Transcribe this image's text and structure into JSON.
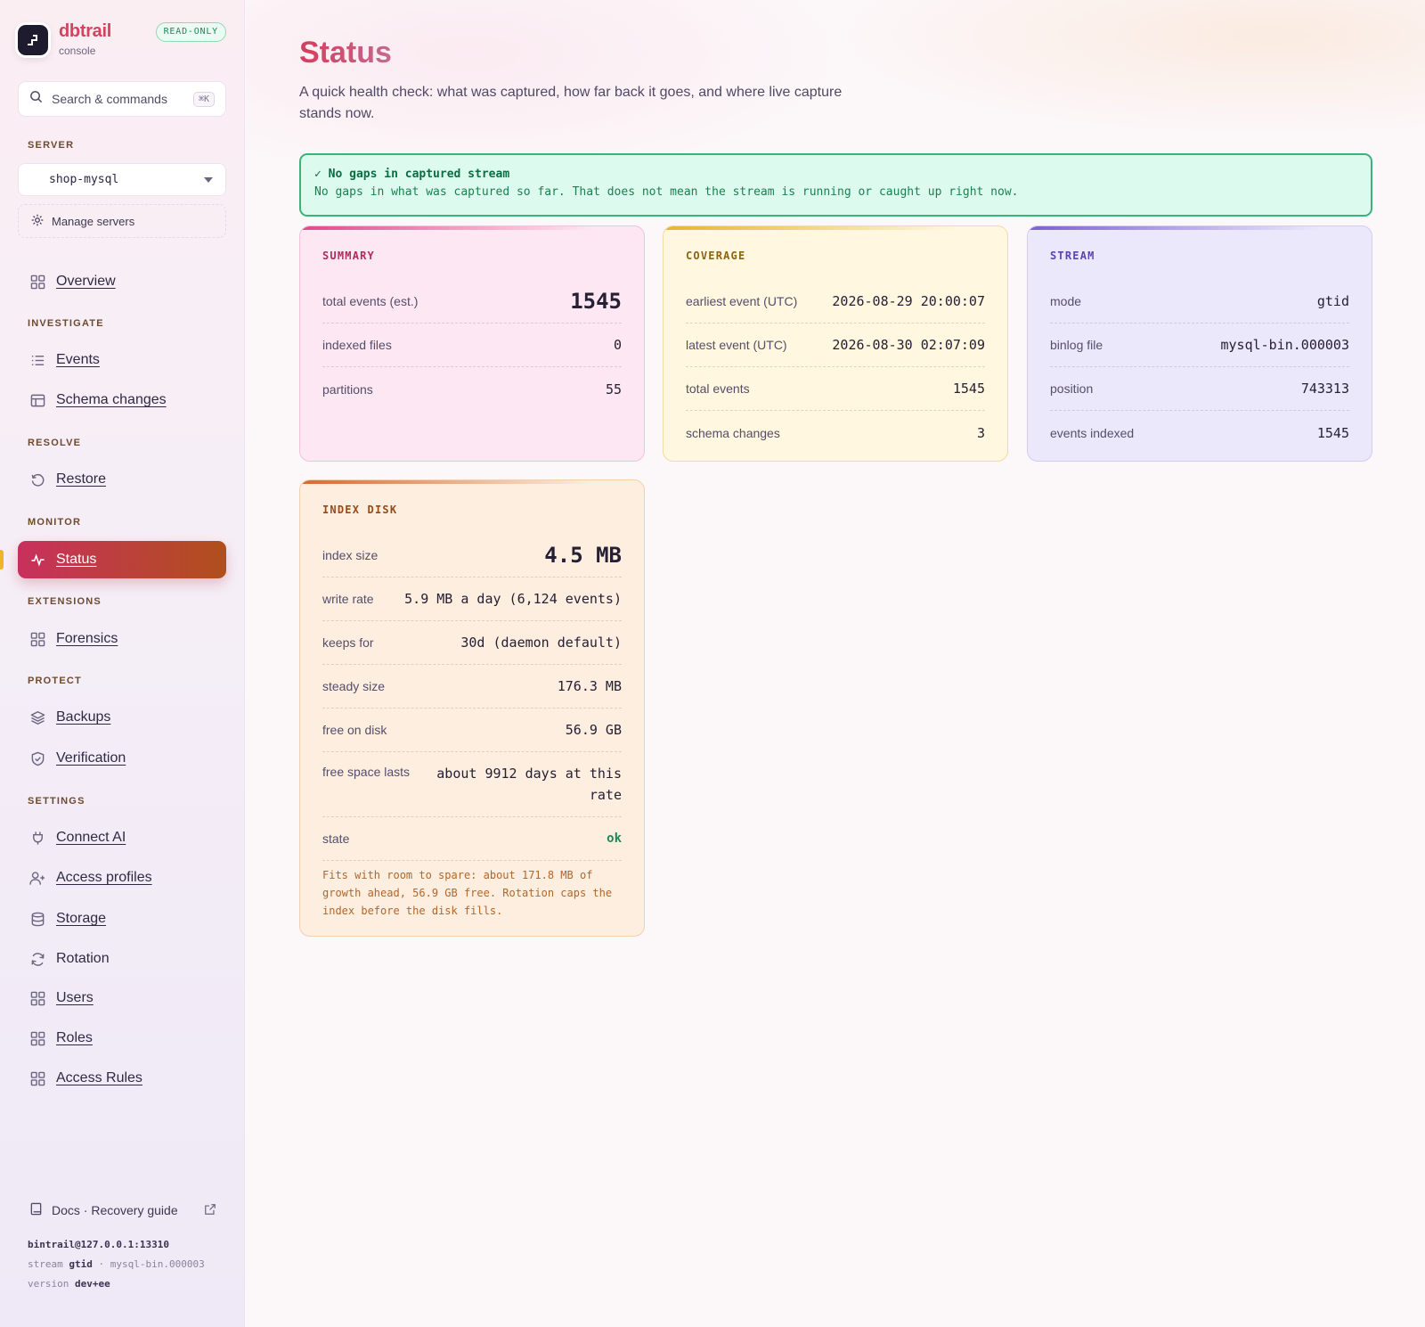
{
  "brand": {
    "name": "dbtrail",
    "sub": "console",
    "badge": "READ-ONLY"
  },
  "search": {
    "label": "Search & commands",
    "shortcut": "⌘K"
  },
  "server": {
    "section": "SERVER",
    "selected": "shop-mysql",
    "manage_label": "Manage servers"
  },
  "sidebar": {
    "overview": "Overview",
    "investigate": {
      "label": "INVESTIGATE",
      "items": [
        "Events",
        "Schema changes"
      ]
    },
    "resolve": {
      "label": "RESOLVE",
      "items": [
        "Restore"
      ]
    },
    "monitor": {
      "label": "MONITOR",
      "items": [
        "Status"
      ]
    },
    "extensions": {
      "label": "EXTENSIONS",
      "items": [
        "Forensics"
      ]
    },
    "protect": {
      "label": "PROTECT",
      "items": [
        "Backups",
        "Verification"
      ]
    },
    "settings": {
      "label": "SETTINGS",
      "items": [
        "Connect AI",
        "Access profiles",
        "Storage",
        "Rotation",
        "Users",
        "Roles",
        "Access Rules"
      ]
    },
    "active_item": "Status"
  },
  "footer": {
    "docs_label": "Docs · Recovery guide",
    "connection": "bintrail@127.0.0.1:13310",
    "stream_prefix": "stream",
    "stream_mode": "gtid",
    "stream_file": "· mysql-bin.000003",
    "version_prefix": "version",
    "version": "dev+ee"
  },
  "page": {
    "title": "Status",
    "description": "A quick health check: what was captured, how far back it goes, and where live capture stands now."
  },
  "banner": {
    "title": "✓ No gaps in captured stream",
    "text": "No gaps in what was captured so far. That does not mean the stream is running or caught up right now."
  },
  "summary": {
    "label": "SUMMARY",
    "total_events_label": "total events (est.)",
    "total_events": "1545",
    "indexed_files_label": "indexed files",
    "indexed_files": "0",
    "partitions_label": "partitions",
    "partitions": "55"
  },
  "coverage": {
    "label": "COVERAGE",
    "earliest_label": "earliest event (UTC)",
    "earliest": "2026-08-29 20:00:07",
    "latest_label": "latest event (UTC)",
    "latest": "2026-08-30 02:07:09",
    "total_events_label": "total events",
    "total_events": "1545",
    "schema_changes_label": "schema changes",
    "schema_changes": "3"
  },
  "stream": {
    "label": "STREAM",
    "mode_label": "mode",
    "mode": "gtid",
    "binlog_label": "binlog file",
    "binlog": "mysql-bin.000003",
    "position_label": "position",
    "position": "743313",
    "indexed_label": "events indexed",
    "indexed": "1545"
  },
  "index_disk": {
    "label": "INDEX DISK",
    "size_label": "index size",
    "size": "4.5 MB",
    "write_rate_label": "write rate",
    "write_rate": "5.9 MB a day (6,124 events)",
    "keeps_label": "keeps for",
    "keeps": "30d (daemon default)",
    "steady_label": "steady size",
    "steady": "176.3 MB",
    "free_label": "free on disk",
    "free": "56.9 GB",
    "lasts_label": "free space lasts",
    "lasts": "about 9912 days at this rate",
    "state_label": "state",
    "state": "ok",
    "note": "Fits with room to spare: about 171.8 MB of growth ahead, 56.9 GB free. Rotation caps the index before the disk fills."
  },
  "colors": {
    "accent": "#c8305d",
    "ok": "#1d8a57",
    "brand": "#d4425f"
  }
}
